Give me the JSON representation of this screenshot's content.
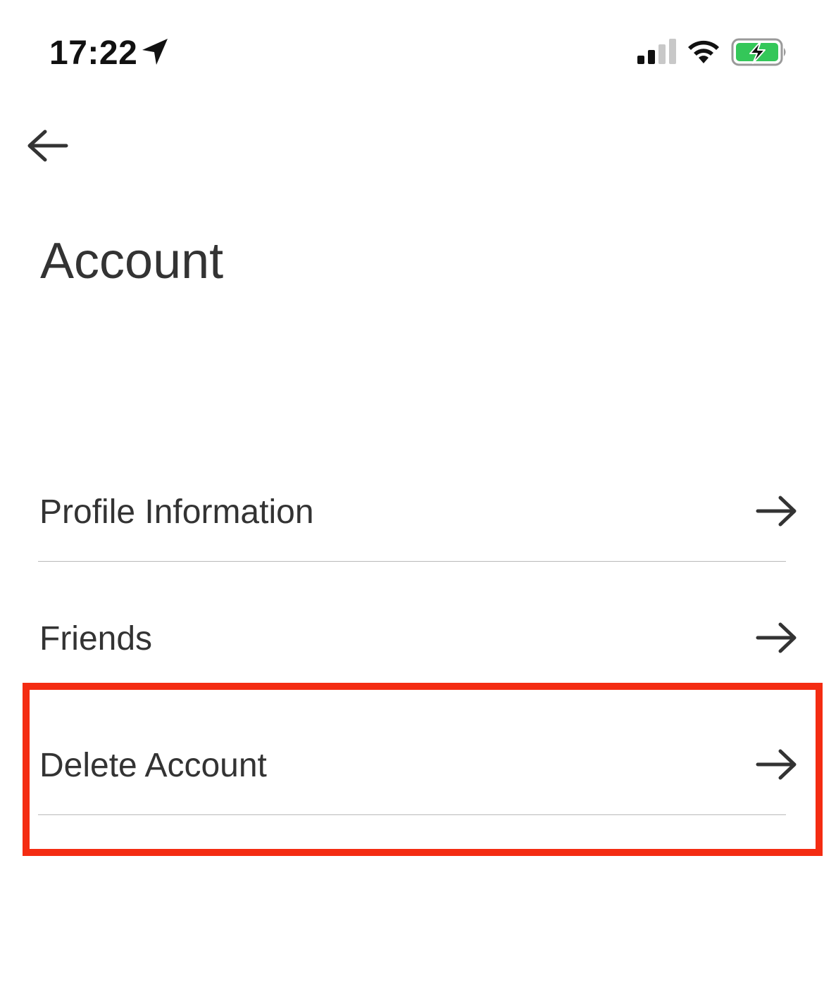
{
  "status_bar": {
    "time": "17:22",
    "icons": [
      "location-arrow-icon",
      "cellular-signal-icon",
      "wifi-icon",
      "battery-charging-icon"
    ],
    "battery_color": "#34c759"
  },
  "navigation": {
    "back_icon": "back-arrow-icon"
  },
  "page": {
    "title": "Account"
  },
  "menu": {
    "items": [
      {
        "label": "Profile Information",
        "icon": "arrow-right-icon"
      },
      {
        "label": "Friends",
        "icon": "arrow-right-icon"
      },
      {
        "label": "Delete Account",
        "icon": "arrow-right-icon"
      }
    ]
  },
  "annotation": {
    "highlight_color": "#f42c12",
    "highlighted_item": "Delete Account"
  }
}
